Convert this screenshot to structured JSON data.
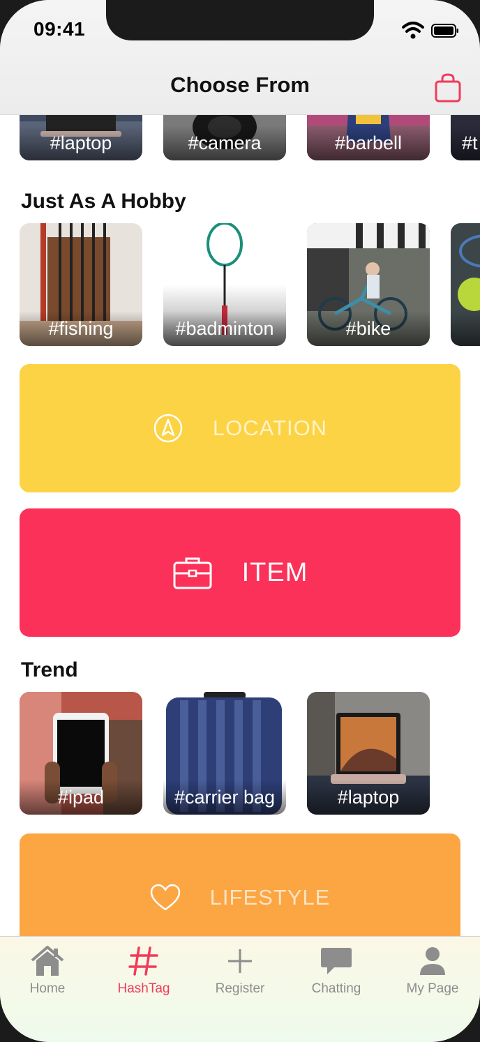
{
  "status_bar": {
    "time": "09:41"
  },
  "nav": {
    "title": "Choose From",
    "bag_icon": "shopping-bag-icon"
  },
  "top_row": {
    "tiles": [
      {
        "label": "#laptop"
      },
      {
        "label": "#camera"
      },
      {
        "label": "#barbell"
      },
      {
        "label": "#t"
      }
    ]
  },
  "hobby": {
    "title": "Just As A Hobby",
    "tiles": [
      {
        "label": "#fishing"
      },
      {
        "label": "#badminton"
      },
      {
        "label": "#bike"
      },
      {
        "label": ""
      }
    ]
  },
  "categories": {
    "location": {
      "label": "LOCATION",
      "icon": "navigation-arrow-icon",
      "color": "#fcd345"
    },
    "item": {
      "label": "ITEM",
      "icon": "briefcase-icon",
      "color": "#fb3159"
    },
    "lifestyle": {
      "label": "LIFESTYLE",
      "icon": "heart-icon",
      "color": "#fba643"
    }
  },
  "trend": {
    "title": "Trend",
    "tiles": [
      {
        "label": "#ipad"
      },
      {
        "label": "#carrier bag"
      },
      {
        "label": "#laptop"
      }
    ]
  },
  "tabbar": {
    "items": [
      {
        "label": "Home",
        "icon": "home-icon"
      },
      {
        "label": "HashTag",
        "icon": "hashtag-icon",
        "active": true
      },
      {
        "label": "Register",
        "icon": "plus-icon"
      },
      {
        "label": "Chatting",
        "icon": "chat-bubble-icon"
      },
      {
        "label": "My Page",
        "icon": "person-icon"
      }
    ],
    "active_color": "#f23a5b",
    "inactive_color": "#8d8d8d"
  }
}
